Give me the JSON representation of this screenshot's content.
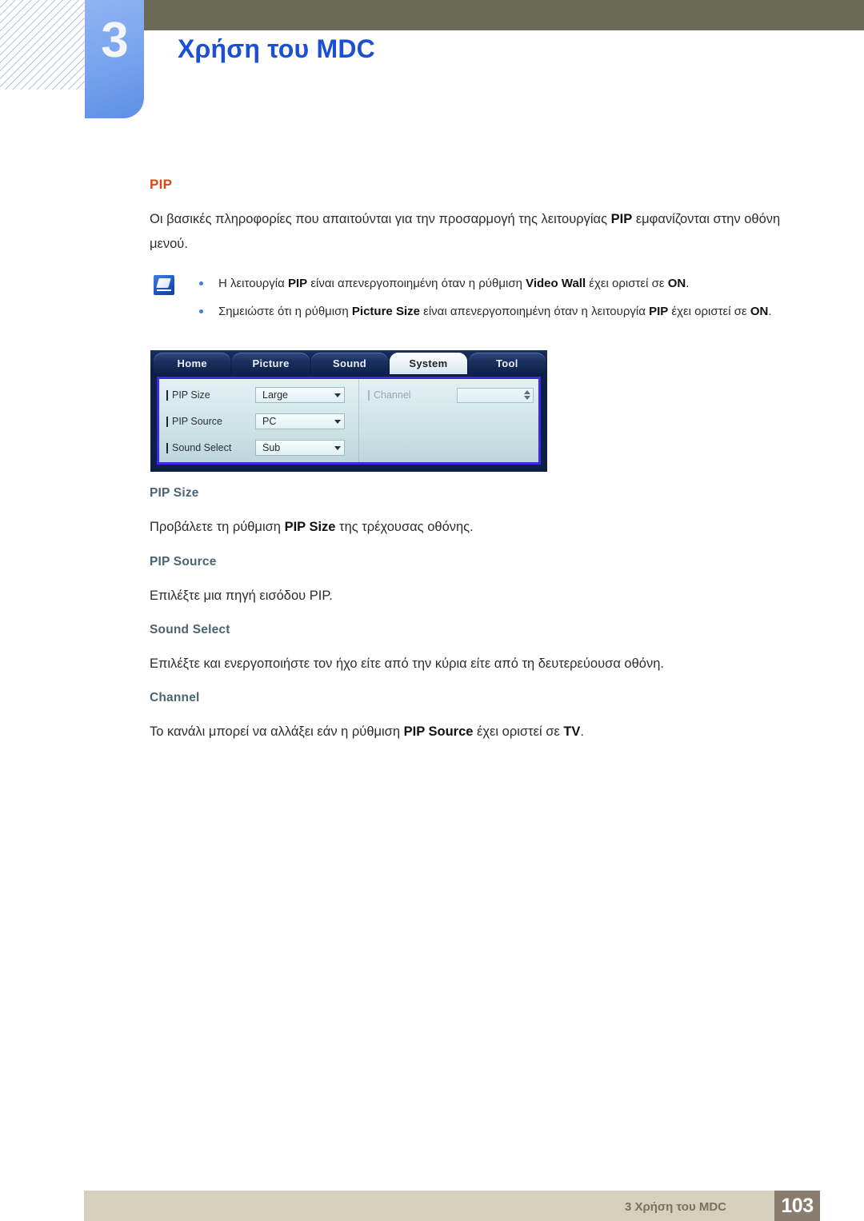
{
  "header": {
    "chapter_number": "3",
    "title": "Χρήση του MDC",
    "accent_blue": "#1b4fd8",
    "olive": "#6b6a55",
    "badge_blue": "#7ba6ef"
  },
  "main": {
    "section_title": "PIP",
    "section_title_color": "#e04410",
    "intro_parts": {
      "p1": "Οι βασικές πληροφορίες που απαιτούνται για την προσαρμογή της λειτουργίας ",
      "b1": "PIP",
      "p2": " εμφανίζονται στην οθόνη μενού."
    },
    "note": {
      "icon": "note-pencil-icon",
      "items": [
        {
          "p1": "Η λειτουργία ",
          "b1": "PIP",
          "p2": " είναι απενεργοποιημένη όταν η ρύθμιση ",
          "b2": "Video Wall",
          "p3": " έχει οριστεί σε ",
          "b3": "ON",
          "p4": "."
        },
        {
          "p1": "Σημειώστε ότι η ρύθμιση ",
          "b1": "Picture Size",
          "p2": " είναι απενεργοποιημένη όταν η λειτουργία ",
          "b2": "PIP",
          "p3": " έχει οριστεί σε ",
          "b3": "ON",
          "p4": "."
        }
      ]
    },
    "osd": {
      "tabs": [
        {
          "label": "Home",
          "active": false
        },
        {
          "label": "Picture",
          "active": false
        },
        {
          "label": "Sound",
          "active": false
        },
        {
          "label": "System",
          "active": true
        },
        {
          "label": "Tool",
          "active": false
        }
      ],
      "left_rows": [
        {
          "label": "PIP Size",
          "value": "Large"
        },
        {
          "label": "PIP Source",
          "value": "PC"
        },
        {
          "label": "Sound Select",
          "value": "Sub"
        }
      ],
      "right_rows": [
        {
          "label": "Channel",
          "value": "",
          "disabled": true
        }
      ],
      "border_color": "#3a28ee"
    },
    "subsections": [
      {
        "heading": "PIP Size",
        "body": {
          "p1": "Προβάλετε τη ρύθμιση ",
          "b1": "PIP Size",
          "p2": " της τρέχουσας οθόνης.",
          "b2": "",
          "p3": ""
        }
      },
      {
        "heading": "PIP Source",
        "body": {
          "p1": "Επιλέξτε μια πηγή εισόδου PIP.",
          "b1": "",
          "p2": "",
          "b2": "",
          "p3": ""
        }
      },
      {
        "heading": "Sound Select",
        "body": {
          "p1": "Επιλέξτε και ενεργοποιήστε τον ήχο είτε από την κύρια είτε από τη δευτερεύουσα οθόνη.",
          "b1": "",
          "p2": "",
          "b2": "",
          "p3": ""
        }
      },
      {
        "heading": "Channel",
        "body": {
          "p1": "Το κανάλι μπορεί να αλλάξει εάν η ρύθμιση ",
          "b1": "PIP Source",
          "p2": " έχει οριστεί σε ",
          "b2": "TV",
          "p3": "."
        }
      }
    ]
  },
  "footer": {
    "text": "3 Χρήση του MDC",
    "page_number": "103",
    "bar_color": "#d6cfbc",
    "page_box_color": "#8a7d6d"
  }
}
